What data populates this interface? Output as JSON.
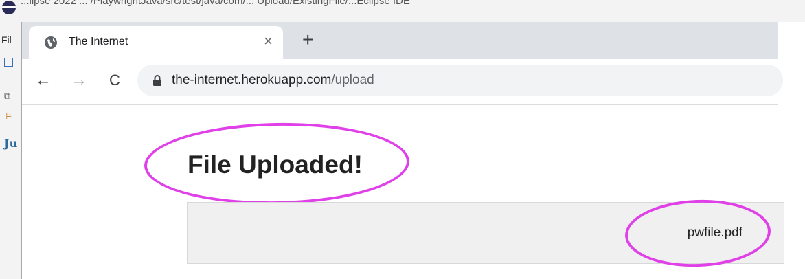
{
  "ide": {
    "title_fragment": "...lipse 2022 ... /PlaywrightJava/src/test/java/com/... Upload/ExistingFile/...Eclipse IDE",
    "menu_fragment": "Fil"
  },
  "browser": {
    "tab": {
      "title": "The Internet",
      "close": "×"
    },
    "new_tab": "+",
    "nav": {
      "back": "←",
      "forward": "→",
      "reload": "C"
    },
    "address": {
      "host": "the-internet.herokuapp.com",
      "path": "/upload"
    }
  },
  "page": {
    "heading": "File Uploaded!",
    "uploaded_file": "pwfile.pdf"
  },
  "colors": {
    "annotation": "#e040e8",
    "tabstrip": "#dee1e6",
    "omnibox": "#f1f3f4",
    "panel": "#f0f0f0"
  },
  "icons": [
    "globe-icon",
    "close-icon",
    "plus-icon",
    "back-arrow-icon",
    "forward-arrow-icon",
    "reload-icon",
    "lock-icon"
  ]
}
